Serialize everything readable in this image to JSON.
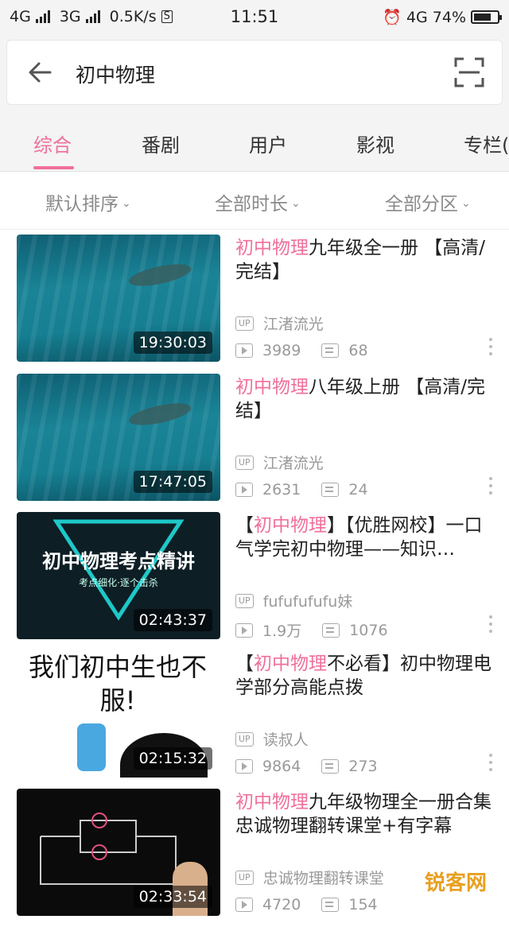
{
  "status": {
    "net1": "4G",
    "net2": "3G",
    "speed": "0.5K/s",
    "speed_badge": "S",
    "time": "11:51",
    "net3": "4G",
    "battery": "74%",
    "battery_level": 0.74
  },
  "search": {
    "query": "初中物理"
  },
  "tabs": [
    "综合",
    "番剧",
    "用户",
    "影视",
    "专栏("
  ],
  "filters": [
    "默认排序",
    "全部时长",
    "全部分区"
  ],
  "up_badge": "UP",
  "videos": [
    {
      "title_hl": "初中物理",
      "title_rest": "九年级全一册 【高清/完结】",
      "title_pre": "",
      "duration": "19:30:03",
      "uploader": "江渚流光",
      "plays": "3989",
      "danmaku": "68",
      "thumb_text": ""
    },
    {
      "title_hl": "初中物理",
      "title_rest": "八年级上册 【高清/完结】",
      "title_pre": "",
      "duration": "17:47:05",
      "uploader": "江渚流光",
      "plays": "2631",
      "danmaku": "24",
      "thumb_text": ""
    },
    {
      "title_pre": "【",
      "title_hl": "初中物理",
      "title_rest": "】【优胜网校】一口气学完初中物理——知识…",
      "duration": "02:43:37",
      "uploader": "fufufufufu妹",
      "plays": "1.9万",
      "danmaku": "1076",
      "thumb_text": "初中物理考点精讲",
      "thumb_sub": "考点细化·逐个击杀"
    },
    {
      "title_pre": "【",
      "title_hl": "初中物理",
      "title_rest": "不必看】初中物理电学部分高能点拨",
      "duration": "02:15:32",
      "uploader": "读叔人",
      "plays": "9864",
      "danmaku": "273",
      "thumb_text": "我们初中生也不服!"
    },
    {
      "title_pre": "",
      "title_hl": "初中物理",
      "title_rest": "九年级物理全一册合集 忠诚物理翻转课堂+有字幕",
      "duration": "02:33:54",
      "uploader": "忠诚物理翻转课堂",
      "plays": "4720",
      "danmaku": "154",
      "thumb_text": ""
    }
  ],
  "watermark": "锐客网"
}
